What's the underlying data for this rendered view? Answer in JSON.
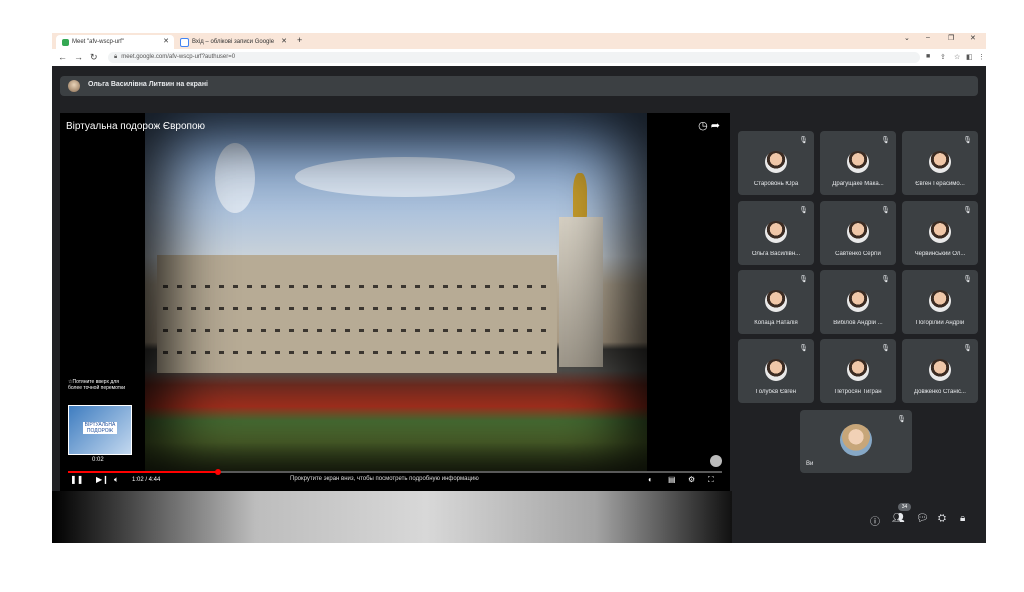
{
  "browser": {
    "tabs": [
      {
        "label": "Meet \"afv-wscp-urf\"",
        "active": true
      },
      {
        "label": "Вхід – облікові записи Google",
        "active": false
      }
    ],
    "url": "meet.google.com/afv-wscp-urf?authuser=0"
  },
  "presenter_bar": {
    "text": "Ольга Василівна Литвин на екрані"
  },
  "video": {
    "title": "Віртуальна подорож Європою",
    "hint": "☆Потяните вверх для более точной перемотки",
    "thumb_label": "ВІРТУАЛЬНА ПОДОРОЖ",
    "thumb_time": "0:02",
    "time": "1:02 / 4:44",
    "progress": 0.23,
    "caption": "Прокрутите экран вниз, чтобы посмотреть подробную информацию"
  },
  "participants": [
    {
      "name": "Старовонь Юра"
    },
    {
      "name": "Драгущаке Мака..."
    },
    {
      "name": "Євген Герасимо..."
    },
    {
      "name": "Ольга Василівн..."
    },
    {
      "name": "Савтенко Сергій"
    },
    {
      "name": "Червинський Ол..."
    },
    {
      "name": "Копаца Наталія"
    },
    {
      "name": "Вибілов Андрій ..."
    },
    {
      "name": "Погорілий Андрій"
    },
    {
      "name": "Голубєв Євген"
    },
    {
      "name": "Петросян Тигран"
    },
    {
      "name": "Довженко Станіс..."
    }
  ],
  "self_tile": {
    "name": "Ви"
  },
  "people_count": "34"
}
